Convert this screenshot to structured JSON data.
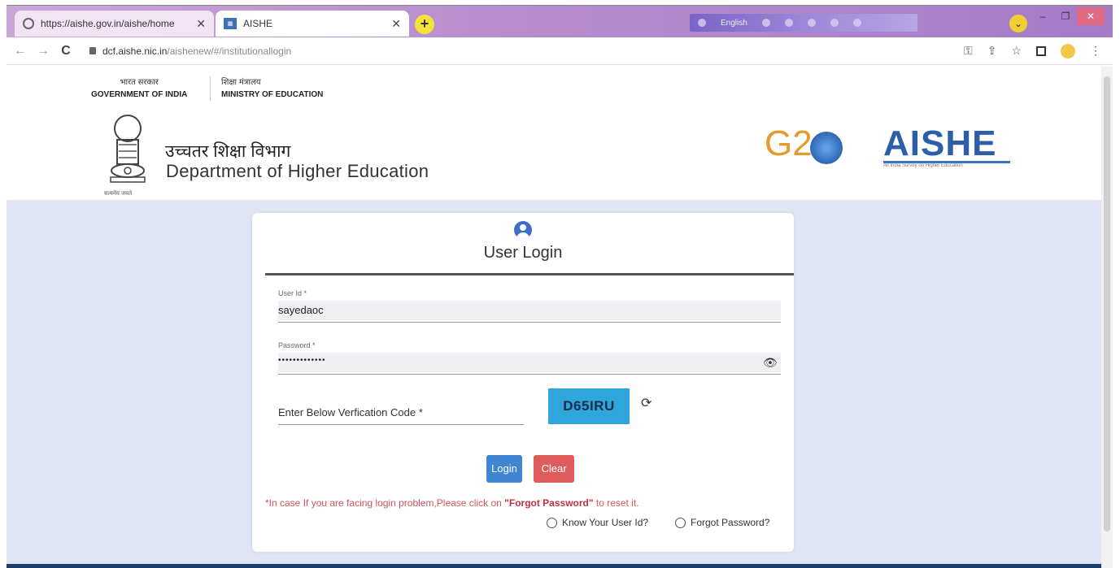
{
  "browser": {
    "tabs": [
      {
        "title": "https://aishe.gov.in/aishe/home",
        "icon": "globe-icon"
      },
      {
        "title": "AISHE",
        "icon": "aishe-favicon-icon"
      }
    ],
    "extension_label": "English",
    "url_host": "dcf.aishe.nic.in",
    "url_path": "/aishenew/#/institutionallogin"
  },
  "header": {
    "gov_hi": "भारत सरकार",
    "gov_en": "GOVERNMENT OF INDIA",
    "ministry_hi": "शिक्षा मंत्रालय",
    "ministry_en": "MINISTRY OF EDUCATION",
    "emblem_caption": "सत्यमेव जयते",
    "dept_hi": "उच्चतर शिक्षा विभाग",
    "dept_en": "Department of Higher Education",
    "g20_text": "G2",
    "aishe_logo": "AISHE",
    "aishe_sub": "All India Survey on Higher Education"
  },
  "login": {
    "title": "User Login",
    "user_label": "User Id *",
    "user_value": "sayedaoc",
    "password_label": "Password *",
    "password_value": "•••••••••••••",
    "captcha_label": "Enter Below Verfication Code *",
    "captcha_code": "D65IRU",
    "login_button": "Login",
    "clear_button": "Clear",
    "notice_prefix": "*In case If you are facing login problem,Please click on ",
    "notice_link": "\"Forgot Password\"",
    "notice_suffix": " to reset it.",
    "know_user_id": "Know Your User Id?",
    "forgot_password": "Forgot Password?"
  },
  "colors": {
    "accent": "#3e86d1",
    "danger": "#de5c5c",
    "captcha_bg": "#2ea6dc",
    "page_bg": "#dfe5f2"
  }
}
